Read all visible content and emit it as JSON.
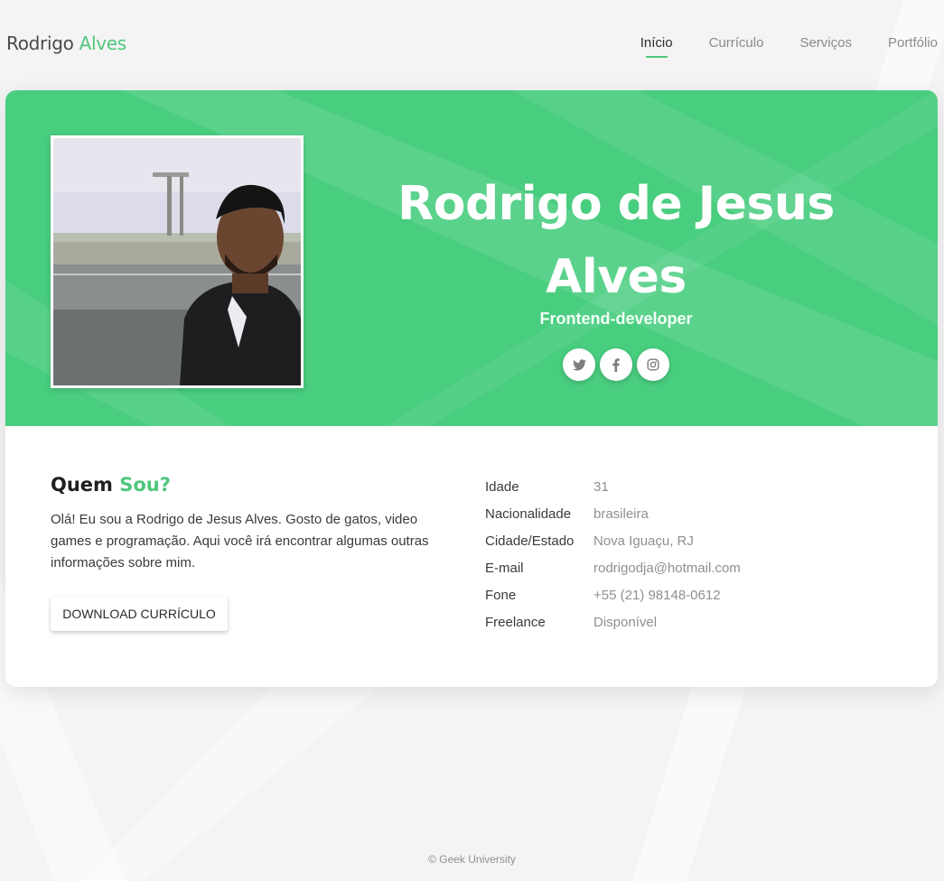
{
  "brand": {
    "first": "Rodrigo",
    "accent": "Alves"
  },
  "nav": {
    "items": [
      {
        "label": "Início",
        "active": true
      },
      {
        "label": "Currículo",
        "active": false
      },
      {
        "label": "Serviços",
        "active": false
      },
      {
        "label": "Portfólio",
        "active": false
      }
    ]
  },
  "hero": {
    "name_line1": "Rodrigo de Jesus",
    "name_line2": "Alves",
    "role": "Frontend-developer",
    "socials": [
      "twitter-icon",
      "facebook-icon",
      "instagram-icon"
    ]
  },
  "about": {
    "title_first": "Quem",
    "title_accent": "Sou?",
    "text": "Olá! Eu sou a Rodrigo de Jesus Alves. Gosto de gatos, video games e programação. Aqui você irá encontrar algumas outras informações sobre mim.",
    "download_label": "DOWNLOAD CURRÍCULO"
  },
  "info": [
    {
      "label": "Idade",
      "value": "31"
    },
    {
      "label": "Nacionalidade",
      "value": "brasileira"
    },
    {
      "label": "Cidade/Estado",
      "value": "Nova Iguaçu, RJ"
    },
    {
      "label": "E-mail",
      "value": "rodrigodja@hotmail.com"
    },
    {
      "label": "Fone",
      "value": "+55 (21) 98148-0612"
    },
    {
      "label": "Freelance",
      "value": "Disponível"
    }
  ],
  "footer": {
    "text": "© Geek University"
  },
  "colors": {
    "accent": "#4fc67c",
    "hero_bg": "#49cd7f",
    "page_bg": "#f4f4f4"
  }
}
